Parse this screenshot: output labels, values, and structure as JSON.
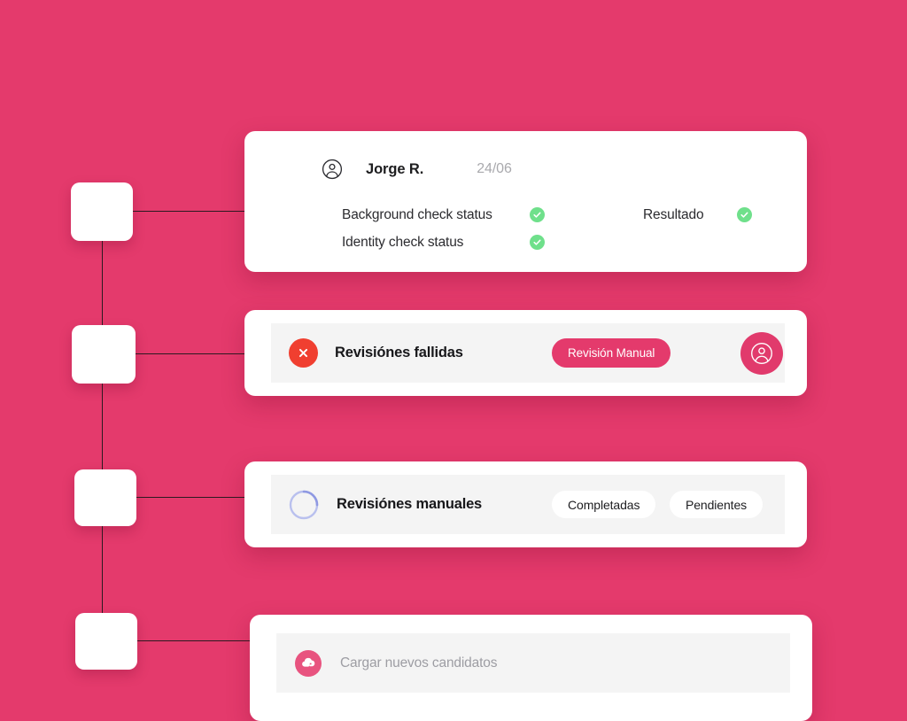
{
  "theme": {
    "background": "#e43a6c",
    "card_bg": "#ffffff",
    "panel_bg": "#f4f4f4",
    "accent_pink": "#e43a6c",
    "success_green": "#6fe08b",
    "error_red": "#f03f30",
    "spinner_blue": "#9aa3e8",
    "upload_pink": "#e8537f",
    "line_color": "#2b1a21"
  },
  "profile_card": {
    "avatar_icon": "user-circle-outline-icon",
    "name": "Jorge R.",
    "date": "24/06",
    "checks": [
      {
        "label": "Background check status",
        "status_icon": "check-circle-icon",
        "status": "ok"
      },
      {
        "label": "Identity check status",
        "status_icon": "check-circle-icon",
        "status": "ok"
      }
    ],
    "result": {
      "label": "Resultado",
      "status_icon": "check-circle-icon",
      "status": "ok"
    }
  },
  "failed_card": {
    "status_icon": "x-circle-icon",
    "title": "Revisiónes fallidas",
    "action_label": "Revisión Manual",
    "avatar_icon": "user-circle-icon"
  },
  "manual_card": {
    "status_icon": "loading-spinner-icon",
    "title": "Revisiónes manuales",
    "buttons": [
      {
        "label": "Completadas"
      },
      {
        "label": "Pendientes"
      }
    ]
  },
  "upload_card": {
    "icon": "cloud-upload-icon",
    "placeholder": "Cargar nuevos candidatos"
  },
  "tree": {
    "nodes": [
      {
        "id": "node-1"
      },
      {
        "id": "node-2"
      },
      {
        "id": "node-3"
      },
      {
        "id": "node-4"
      }
    ]
  }
}
